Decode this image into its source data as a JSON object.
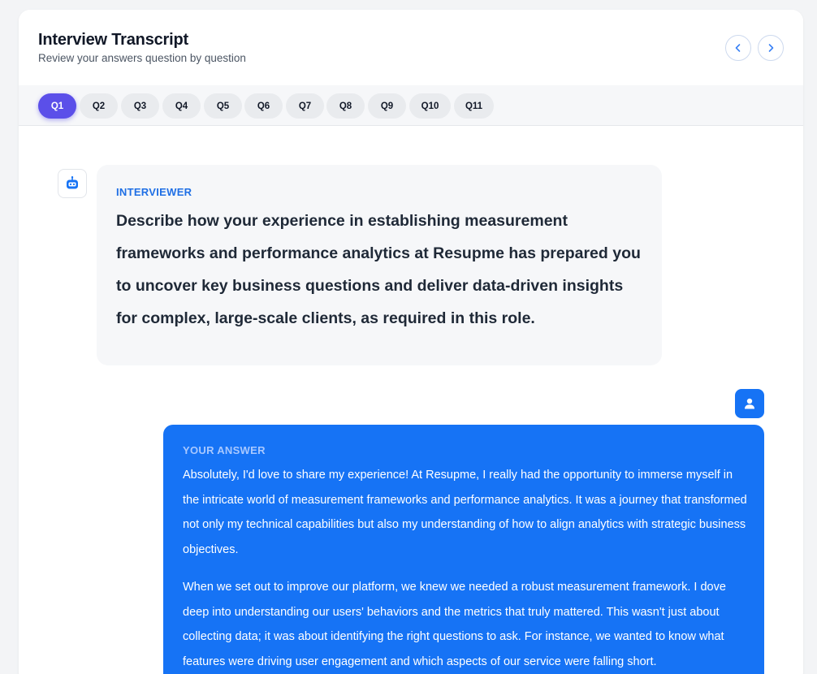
{
  "header": {
    "title": "Interview Transcript",
    "subtitle": "Review your answers question by question",
    "prev_icon": "chevron-left-icon",
    "next_icon": "chevron-right-icon"
  },
  "tabs": [
    {
      "label": "Q1",
      "active": true
    },
    {
      "label": "Q2"
    },
    {
      "label": "Q3"
    },
    {
      "label": "Q4"
    },
    {
      "label": "Q5"
    },
    {
      "label": "Q6"
    },
    {
      "label": "Q7"
    },
    {
      "label": "Q8"
    },
    {
      "label": "Q9"
    },
    {
      "label": "Q10"
    },
    {
      "label": "Q11"
    }
  ],
  "question": {
    "label": "INTERVIEWER",
    "icon": "robot-icon",
    "text": "Describe how your experience in establishing measurement frameworks and performance analytics at Resupme has prepared you to uncover key business questions and deliver data-driven insights for complex, large-scale clients, as required in this role."
  },
  "answer": {
    "label": "YOUR ANSWER",
    "icon": "user-icon",
    "paragraphs": [
      "Absolutely, I'd love to share my experience! At Resupme, I really had the opportunity to immerse myself in the intricate world of measurement frameworks and performance analytics. It was a journey that transformed not only my technical capabilities but also my understanding of how to align analytics with strategic business objectives.",
      "When we set out to improve our platform, we knew we needed a robust measurement framework. I dove deep into understanding our users' behaviors and the metrics that truly mattered. This wasn't just about collecting data; it was about identifying the right questions to ask. For instance, we wanted to know what features were driving user engagement and which aspects of our service were falling short."
    ]
  },
  "colors": {
    "accent": "#5b4fe9",
    "answer_bg": "#1673f5",
    "label_blue": "#1f6fe5"
  }
}
